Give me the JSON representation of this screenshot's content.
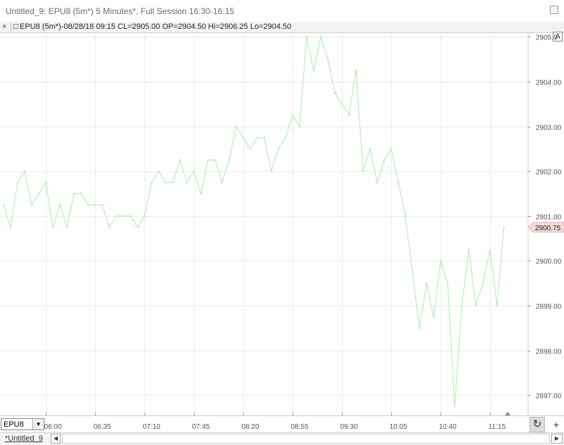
{
  "window": {
    "title": "Untitled_9: EPU8 (5m*) 5 Minutes*, Full Session 16:30-16:15"
  },
  "infobar": {
    "close_glyph": "×",
    "text": "EPU8 (5m*)-08/28/18 09:15 CL=2905.00 OP=2904.50 Hi=2906.25 Lo=2904.50"
  },
  "toolbar": {
    "a_button": "A"
  },
  "bottom": {
    "instrument": "EPU8",
    "dropdown_glyph": "▼",
    "refresh_glyph": "↻",
    "add_glyph": "+"
  },
  "tabs": [
    {
      "label": "*Untitled_9"
    }
  ],
  "scroll": {
    "left": "◀",
    "right": "▶"
  },
  "colors": {
    "line": "#a6f0a6",
    "grid": "#ececec",
    "price_marker_bg": "#f3dada",
    "axis_text": "#555555"
  },
  "chart_data": {
    "type": "line",
    "series": [
      {
        "values": [
          2901.25,
          2900.75,
          2901.75,
          2902.0,
          2901.25,
          2901.5,
          2901.75,
          2900.75,
          2901.25,
          2900.75,
          2901.5,
          2901.5,
          2901.25,
          2901.25,
          2901.25,
          2900.75,
          2901.0,
          2901.0,
          2901.0,
          2900.75,
          2901.0,
          2901.75,
          2902.0,
          2901.75,
          2901.75,
          2902.25,
          2901.75,
          2902.0,
          2901.5,
          2902.25,
          2902.25,
          2901.75,
          2902.25,
          2903.0,
          2902.75,
          2902.5,
          2902.75,
          2902.75,
          2902.0,
          2902.5,
          2902.75,
          2903.25,
          2903.0,
          2905.0,
          2904.25,
          2905.0,
          2904.5,
          2903.75,
          2903.5,
          2903.25,
          2904.25,
          2902.0,
          2902.5,
          2901.75,
          2902.25,
          2902.5,
          2901.75,
          2901.0,
          2899.75,
          2898.5,
          2899.5,
          2898.75,
          2900.0,
          2899.5,
          2896.75,
          2899.0,
          2900.25,
          2899.0,
          2899.5,
          2900.25,
          2899.0,
          2900.75
        ]
      }
    ],
    "x_tick_labels": [
      "06:00",
      "06:35",
      "07:10",
      "07:45",
      "08:20",
      "08:55",
      "09:30",
      "10:05",
      "10:40",
      "11:15"
    ],
    "y_tick_values": [
      2897.0,
      2898.0,
      2899.0,
      2900.0,
      2901.0,
      2902.0,
      2903.0,
      2904.0,
      2905.0
    ],
    "y_tick_labels": [
      "2897.00",
      "2898.00",
      "2899.00",
      "2900.00",
      "2901.00",
      "2902.00",
      "2903.00",
      "2904.00",
      "2905.0"
    ],
    "ylim": [
      2896.55,
      2905.1
    ],
    "current_price": 2900.75,
    "current_price_label": "2900.75",
    "grid": true
  }
}
